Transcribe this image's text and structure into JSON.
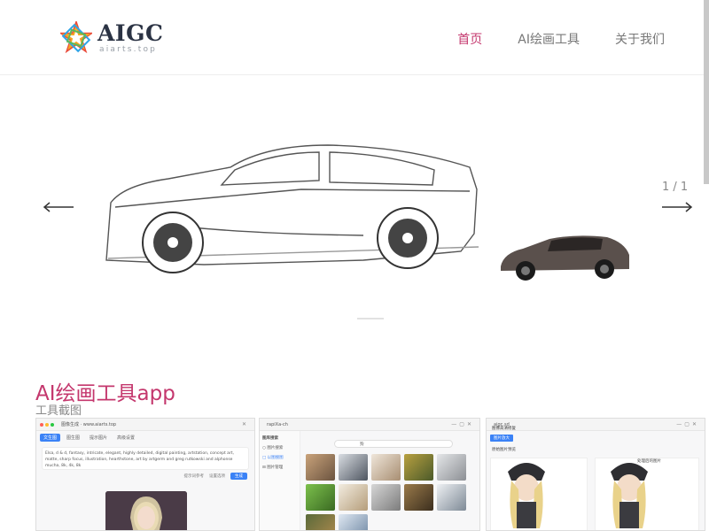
{
  "header": {
    "logo_text": "AIGC",
    "logo_sub": "aiarts.top",
    "nav": [
      {
        "label": "首页",
        "active": true
      },
      {
        "label": "AI绘画工具",
        "active": false
      },
      {
        "label": "关于我们",
        "active": false
      }
    ]
  },
  "hero": {
    "slide_counter": "1 / 1",
    "icons": {
      "prev": "arrow-left-icon",
      "next": "arrow-right-icon"
    }
  },
  "section": {
    "title": "AI绘画工具app",
    "subtitle": "工具截图"
  },
  "screenshots": [
    {
      "window_title": "图像生成 · www.aiarts.top",
      "tabs": [
        "文生图",
        "图生图",
        "提示图片",
        "高级设置"
      ],
      "prompt_text": "Elsa, d & d, fantasy, intricate, elegant, highly detailed, digital painting, artstation, concept art, matte, sharp focus, illustration, hearthstone, art by artgerm and greg rutkowski and alphonse mucha, 8k, 4k, 8k",
      "actions": [
        "提示词参考",
        "设置选项"
      ],
      "generate": "生成"
    },
    {
      "window_title": "rapiXa-ch",
      "side_title": "图库搜索",
      "side_items": [
        "○ 图片搜索",
        "□ 以图搜图",
        "⊟ 图片管理"
      ],
      "search_value": "狗"
    },
    {
      "window_title": "aigc.sd",
      "side_title": "图像高清修复",
      "tag": "图片放大",
      "left_label": "原始图片预览",
      "right_label": "处理后的图片"
    }
  ],
  "colors": {
    "accent": "#c4376d",
    "blue": "#3b82f6"
  }
}
